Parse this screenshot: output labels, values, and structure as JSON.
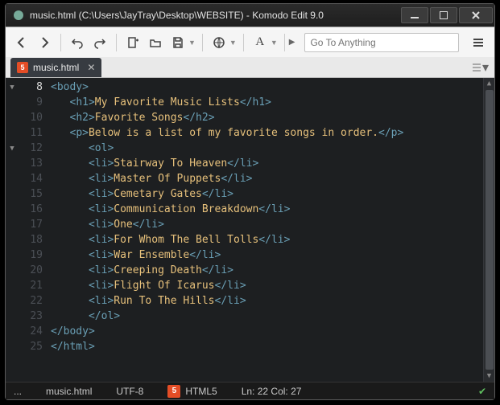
{
  "window": {
    "title": "music.html (C:\\Users\\JayTray\\Desktop\\WEBSITE) - Komodo Edit 9.0"
  },
  "toolbar": {
    "goto_placeholder": "Go To Anything"
  },
  "tab": {
    "label": "music.html"
  },
  "gutter": {
    "lines": [
      "8",
      "9",
      "10",
      "11",
      "12",
      "13",
      "14",
      "15",
      "16",
      "17",
      "18",
      "19",
      "20",
      "21",
      "22",
      "23",
      "24",
      "25"
    ],
    "current": "8",
    "fold_at": [
      "8",
      "12"
    ]
  },
  "code": {
    "lines": [
      {
        "indent": 0,
        "open": "body",
        "text": "",
        "close": ""
      },
      {
        "indent": 1,
        "open": "h1",
        "text": "My Favorite Music Lists",
        "close": "h1"
      },
      {
        "indent": 1,
        "open": "h2",
        "text": "Favorite Songs",
        "close": "h2"
      },
      {
        "indent": 1,
        "open": "p",
        "text": "Below is a list of my favorite songs in order.",
        "close": "p"
      },
      {
        "indent": 2,
        "open": "ol",
        "text": "",
        "close": ""
      },
      {
        "indent": 2,
        "open": "li",
        "text": "Stairway To Heaven",
        "close": "li"
      },
      {
        "indent": 2,
        "open": "li",
        "text": "Master Of Puppets",
        "close": "li"
      },
      {
        "indent": 2,
        "open": "li",
        "text": "Cemetary Gates",
        "close": "li"
      },
      {
        "indent": 2,
        "open": "li",
        "text": "Communication Breakdown",
        "close": "li"
      },
      {
        "indent": 2,
        "open": "li",
        "text": "One",
        "close": "li"
      },
      {
        "indent": 2,
        "open": "li",
        "text": "For Whom The Bell Tolls",
        "close": "li"
      },
      {
        "indent": 2,
        "open": "li",
        "text": "War Ensemble",
        "close": "li"
      },
      {
        "indent": 2,
        "open": "li",
        "text": "Creeping Death",
        "close": "li"
      },
      {
        "indent": 2,
        "open": "li",
        "text": "Flight Of Icarus",
        "close": "li"
      },
      {
        "indent": 2,
        "open": "li",
        "text": "Run To The Hills",
        "close": "li"
      },
      {
        "indent": 2,
        "open": "",
        "text": "",
        "close": "ol"
      },
      {
        "indent": 0,
        "open": "",
        "text": "",
        "close": "body"
      },
      {
        "indent": 0,
        "open": "",
        "text": "",
        "close": "html"
      }
    ]
  },
  "status": {
    "dots": "...",
    "file": "music.html",
    "encoding": "UTF-8",
    "doctype": "HTML5",
    "pos": "Ln: 22 Col: 27"
  }
}
